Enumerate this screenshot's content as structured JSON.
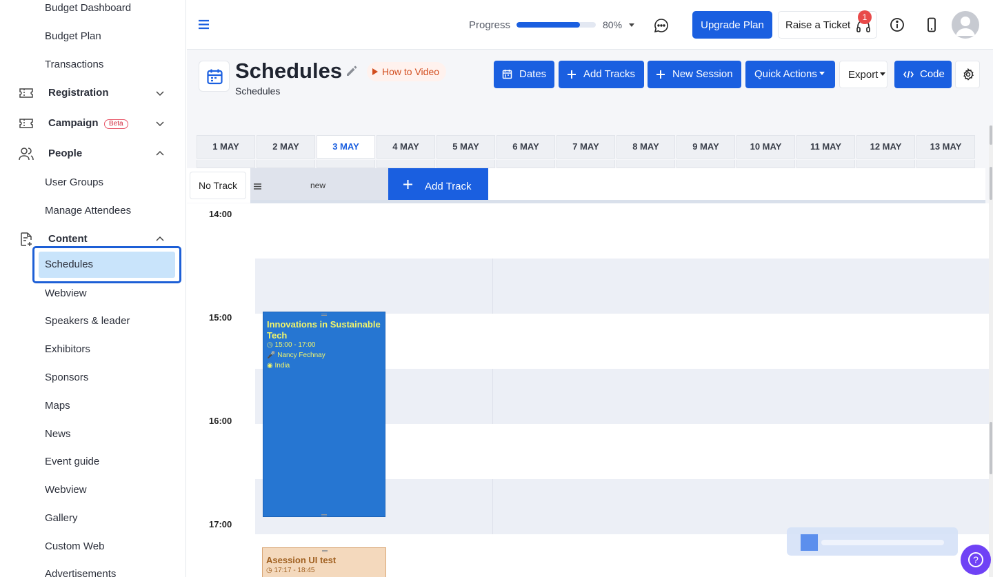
{
  "sidebar": {
    "top_items": [
      "Budget Dashboard",
      "Budget Plan",
      "Transactions"
    ],
    "groups": {
      "registration": "Registration",
      "campaign": "Campaign",
      "campaign_badge": "Beta",
      "people": "People",
      "content": "Content"
    },
    "people_items": [
      "User Groups",
      "Manage Attendees"
    ],
    "active_item": "Schedules",
    "content_items": [
      "Webview",
      "Speakers & leader",
      "Exhibitors",
      "Sponsors",
      "Maps",
      "News",
      "Event guide",
      "Webview",
      "Gallery",
      "Custom Web",
      "Advertisements"
    ]
  },
  "topbar": {
    "progress_label": "Progress",
    "progress_value": 0.8,
    "progress_text": "80%",
    "upgrade_label": "Upgrade Plan",
    "ticket_label": "Raise a Ticket",
    "notification_count": "1"
  },
  "page": {
    "title": "Schedules",
    "subtitle": "Schedules",
    "how_to_label": "How to Video"
  },
  "toolbar": {
    "dates": "Dates",
    "add_tracks": "Add Tracks",
    "new_session": "New Session",
    "quick_actions": "Quick Actions",
    "export": "Export",
    "code": "Code"
  },
  "dates": [
    "1 MAY",
    "2 MAY",
    "3 MAY",
    "4 MAY",
    "5 MAY",
    "6 MAY",
    "7 MAY",
    "8 MAY",
    "9 MAY",
    "10 MAY",
    "11 MAY",
    "12 MAY",
    "13 MAY"
  ],
  "active_date": "3 MAY",
  "tracks": {
    "no_track": "No Track",
    "track_name": "new",
    "add_track": "Add Track"
  },
  "times": [
    "14:00",
    "15:00",
    "16:00",
    "17:00"
  ],
  "sessions": [
    {
      "title": "Innovations in Sustainable Tech",
      "time": "15:00 - 17:00",
      "speaker": "Nancy Fechnay",
      "location": "India",
      "color": "#2676d2",
      "text_color": "#f2f56b"
    },
    {
      "title": "Asession UI test",
      "time": "17:17 - 18:45",
      "color": "#f4d9bd",
      "text_color": "#a06020"
    }
  ],
  "colors": {
    "primary": "#1a5fe0",
    "active_bg": "#c9e4fb",
    "help": "#6f42f5"
  }
}
